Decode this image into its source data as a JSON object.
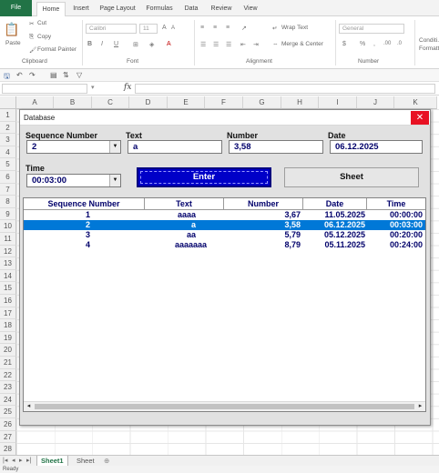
{
  "ribbon": {
    "tabs": [
      "File",
      "Home",
      "Insert",
      "Page Layout",
      "Formulas",
      "Data",
      "Review",
      "View"
    ],
    "clipboard": {
      "paste": "Paste",
      "cut": "Cut",
      "copy": "Copy",
      "format_painter": "Format Painter",
      "label": "Clipboard"
    },
    "font": {
      "name": "Calibri",
      "size": "11",
      "label": "Font"
    },
    "alignment": {
      "wrap_text": "Wrap Text",
      "merge_center": "Merge & Center",
      "label": "Alignment"
    },
    "number": {
      "format": "General",
      "label": "Number"
    },
    "conditional": "Conditi... Formatt..."
  },
  "grid": {
    "columns": [
      "A",
      "B",
      "C",
      "D",
      "E",
      "F",
      "G",
      "H",
      "I",
      "J",
      "K"
    ],
    "rows": [
      "1",
      "2",
      "3",
      "4",
      "5",
      "6",
      "7",
      "8",
      "9",
      "10",
      "11",
      "12",
      "13",
      "14",
      "15",
      "16",
      "17",
      "18",
      "19",
      "20",
      "21",
      "22",
      "23",
      "24",
      "25",
      "26",
      "27",
      "28"
    ]
  },
  "sheets": {
    "active": "Sheet1",
    "other": "Sheet"
  },
  "status": "Ready",
  "dialog": {
    "title": "Database",
    "close_glyph": "✕",
    "labels": {
      "sequence": "Sequence Number",
      "text": "Text",
      "number": "Number",
      "date": "Date",
      "time": "Time"
    },
    "values": {
      "sequence": "2",
      "text": "a",
      "number": "3,58",
      "date": "06.12.2025",
      "time": "00:03:00"
    },
    "buttons": {
      "enter": "Enter",
      "sheet": "Sheet"
    },
    "list": {
      "headers": [
        "Sequence Number",
        "Text",
        "Number",
        "Date",
        "Time"
      ],
      "rows": [
        [
          "1",
          "aaaa",
          "3,67",
          "11.05.2025",
          "00:00:00"
        ],
        [
          "2",
          "a",
          "3,58",
          "06.12.2025",
          "00:03:00"
        ],
        [
          "3",
          "aa",
          "5,79",
          "05.12.2025",
          "00:20:00"
        ],
        [
          "4",
          "aaaaaaa",
          "8,79",
          "05.11.2025",
          "00:24:00"
        ]
      ],
      "selected_row": 2
    }
  },
  "colors": {
    "excel_green": "#217346",
    "enter_button": "#0000c8",
    "selection": "#0078d7",
    "close": "#e81123",
    "text_navy": "#00006b"
  }
}
